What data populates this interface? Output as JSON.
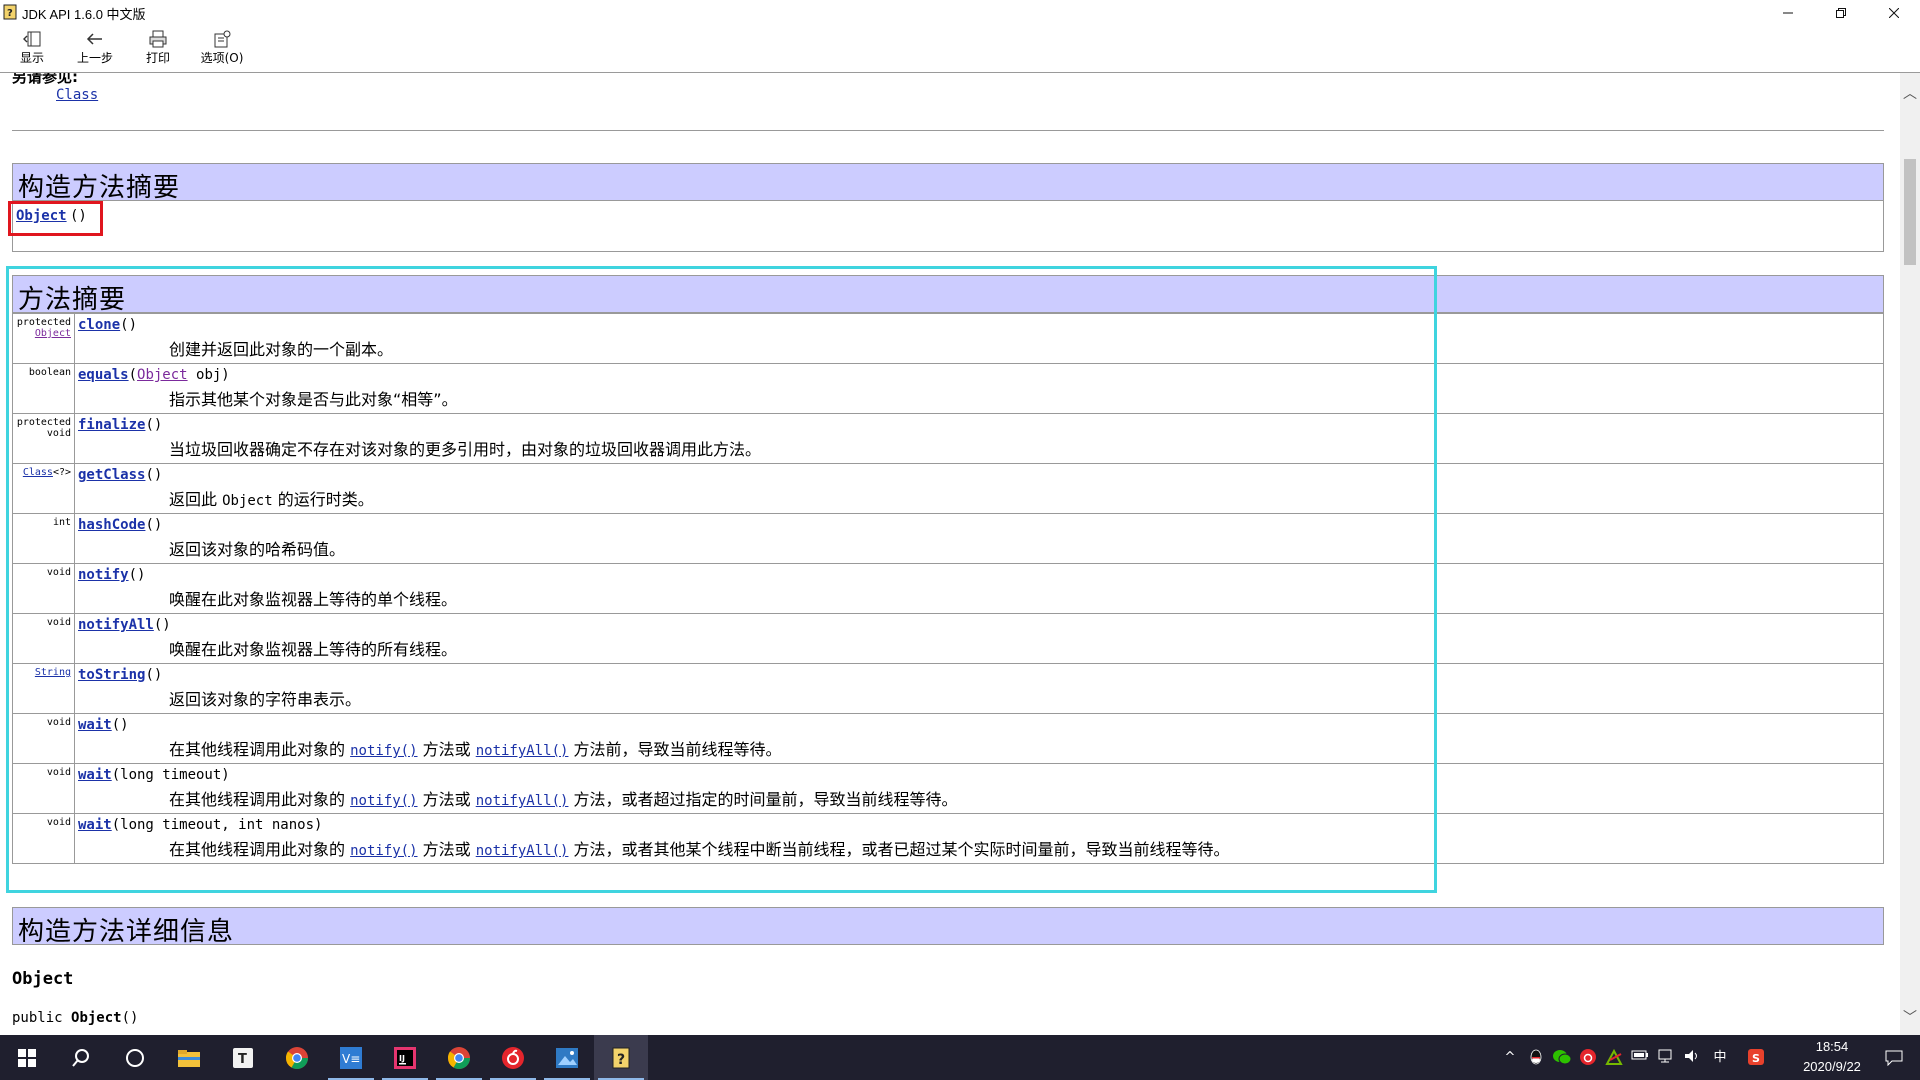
{
  "window": {
    "title": "JDK API 1.6.0 中文版",
    "min_icon": "minimize-icon",
    "max_icon": "restore-icon",
    "close_icon": "close-icon"
  },
  "toolbar": {
    "show_label": "显示",
    "back_label": "上一步",
    "print_label": "打印",
    "options_label": "选项(O)"
  },
  "doc": {
    "see_also_label": "另请参见:",
    "see_also_link": "Class",
    "ctor_summary_title": "构造方法摘要",
    "ctor_name": "Object",
    "ctor_parens": "()",
    "method_summary_title": "方法摘要",
    "methods": [
      {
        "type_prefix": "protected",
        "type_link": "Object",
        "type_suffix": "",
        "name": "clone",
        "params": "()",
        "desc_before": "创建并返回此对象的一个副本。",
        "desc_mid": "",
        "desc_after": "",
        "link1": "",
        "link2": "",
        "code": ""
      },
      {
        "type_prefix": "boolean",
        "type_link": "",
        "type_suffix": "",
        "name": "equals",
        "params_open": "(",
        "param_link": "Object",
        "params_rest": " obj)",
        "desc_before": "指示其他某个对象是否与此对象“相等”。"
      },
      {
        "type_prefix": "protected",
        "type_link": "",
        "type_suffix": "void",
        "name": "finalize",
        "params": "()",
        "desc_before": "当垃圾回收器确定不存在对该对象的更多引用时，由对象的垃圾回收器调用此方法。"
      },
      {
        "type_prefix": "",
        "type_link": "Class",
        "type_suffix": "<?>",
        "name": "getClass",
        "params": "()",
        "desc_before": "返回此 ",
        "code": "Object",
        "desc_after": " 的运行时类。"
      },
      {
        "type_prefix": "int",
        "type_link": "",
        "type_suffix": "",
        "name": "hashCode",
        "params": "()",
        "desc_before": "返回该对象的哈希码值。"
      },
      {
        "type_prefix": "void",
        "type_link": "",
        "type_suffix": "",
        "name": "notify",
        "params": "()",
        "desc_before": "唤醒在此对象监视器上等待的单个线程。"
      },
      {
        "type_prefix": "void",
        "type_link": "",
        "type_suffix": "",
        "name": "notifyAll",
        "params": "()",
        "desc_before": "唤醒在此对象监视器上等待的所有线程。"
      },
      {
        "type_prefix": "",
        "type_link": "String",
        "type_suffix": "",
        "name": "toString",
        "params": "()",
        "desc_before": "返回该对象的字符串表示。"
      },
      {
        "type_prefix": "void",
        "type_link": "",
        "type_suffix": "",
        "name": "wait",
        "params": "()",
        "desc_before": "在其他线程调用此对象的 ",
        "link1": "notify()",
        "desc_mid": " 方法或 ",
        "link2": "notifyAll()",
        "desc_after": " 方法前，导致当前线程等待。"
      },
      {
        "type_prefix": "void",
        "type_link": "",
        "type_suffix": "",
        "name": "wait",
        "params": "(long timeout)",
        "desc_before": "在其他线程调用此对象的 ",
        "link1": "notify()",
        "desc_mid": " 方法或 ",
        "link2": "notifyAll()",
        "desc_after": " 方法，或者超过指定的时间量前，导致当前线程等待。"
      },
      {
        "type_prefix": "void",
        "type_link": "",
        "type_suffix": "",
        "name": "wait",
        "params": "(long timeout, int nanos)",
        "desc_before": "在其他线程调用此对象的 ",
        "link1": "notify()",
        "desc_mid": " 方法或 ",
        "link2": "notifyAll()",
        "desc_after": " 方法，或者其他某个线程中断当前线程，或者已超过某个实际时间量前，导致当前线程等待。"
      }
    ],
    "ctor_detail_title": "构造方法详细信息",
    "detail_name": "Object",
    "detail_sig_prefix": "public ",
    "detail_sig_name": "Object",
    "detail_sig_suffix": "()"
  },
  "annotations": {
    "ctor_box_color": "#e0161e",
    "methods_box_color": "#3fd4df"
  },
  "taskbar": {
    "icons": [
      "windows-start-icon",
      "search-icon",
      "task-view-icon",
      "file-explorer-icon",
      "typora-icon",
      "chrome-icon",
      "vs-code-icon",
      "intellij-idea-icon",
      "chrome-icon",
      "netease-music-icon",
      "photos-icon",
      "help-viewer-icon"
    ],
    "tray_icons": [
      "show-hidden-icons-chevron",
      "qq-icon",
      "wechat-icon",
      "netease-music-tray-icon",
      "nvidia-icon",
      "battery-icon",
      "network-icon",
      "volume-icon",
      "input-method-icon",
      "sogou-icon"
    ],
    "ime_label": "中",
    "time": "18:54",
    "date": "2020/9/22"
  }
}
